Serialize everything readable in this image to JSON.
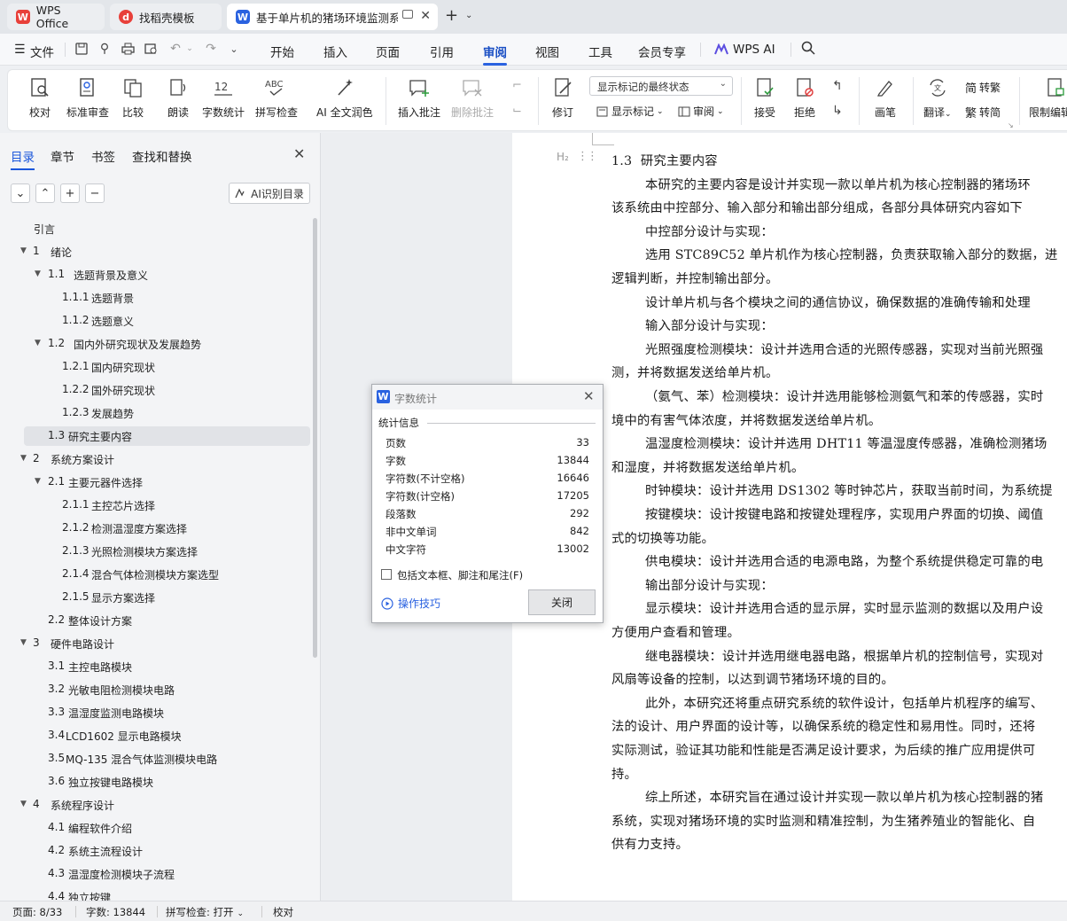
{
  "tabs": {
    "wps_office": "WPS Office",
    "template": "找稻壳模板",
    "document": "基于单片机的猪场环境监测系"
  },
  "menu": {
    "file": "文件",
    "items": [
      "开始",
      "插入",
      "页面",
      "引用",
      "审阅",
      "视图",
      "工具",
      "会员专享"
    ],
    "active": "审阅",
    "wps_ai": "WPS AI"
  },
  "ribbon": {
    "proofread": "校对",
    "standard_review": "标准审查",
    "compare": "比较",
    "read_aloud": "朗读",
    "word_count": "字数统计",
    "spell_check": "拼写检查",
    "ai_polish": "AI 全文润色",
    "insert_comment": "插入批注",
    "delete_comment": "删除批注",
    "track_changes": "修订",
    "markup_select": "显示标记的最终状态",
    "show_markup": "显示标记",
    "review": "审阅",
    "accept": "接受",
    "reject": "拒绝",
    "pen": "画笔",
    "translate": "翻译",
    "to_traditional": "转繁",
    "to_simplified": "转简",
    "restrict_edit": "限制编辑"
  },
  "nav": {
    "tabs": [
      "目录",
      "章节",
      "书签",
      "查找和替换"
    ],
    "active_tab": "目录",
    "ai_toc": "AI识别目录",
    "toc": [
      {
        "num": "",
        "label": "引言",
        "level": 0,
        "toggle": ""
      },
      {
        "num": "1",
        "label": "绪论",
        "level": 0,
        "toggle": "▼"
      },
      {
        "num": "1.1",
        "label": "选题背景及意义",
        "level": 1,
        "toggle": "▼"
      },
      {
        "num": "1.1.1",
        "label": "选题背景",
        "level": 2,
        "toggle": ""
      },
      {
        "num": "1.1.2",
        "label": "选题意义",
        "level": 2,
        "toggle": ""
      },
      {
        "num": "1.2",
        "label": "国内外研究现状及发展趋势",
        "level": 1,
        "toggle": "▼"
      },
      {
        "num": "1.2.1",
        "label": "国内研究现状",
        "level": 2,
        "toggle": ""
      },
      {
        "num": "1.2.2",
        "label": "国外研究现状",
        "level": 2,
        "toggle": ""
      },
      {
        "num": "1.2.3",
        "label": "发展趋势",
        "level": 2,
        "toggle": ""
      },
      {
        "num": "1.3",
        "label": "研究主要内容",
        "level": 1,
        "toggle": "",
        "selected": true
      },
      {
        "num": "2",
        "label": "系统方案设计",
        "level": 0,
        "toggle": "▼"
      },
      {
        "num": "2.1",
        "label": "主要元器件选择",
        "level": 1,
        "toggle": "▼"
      },
      {
        "num": "2.1.1",
        "label": "主控芯片选择",
        "level": 2,
        "toggle": ""
      },
      {
        "num": "2.1.2",
        "label": "检测温湿度方案选择",
        "level": 2,
        "toggle": ""
      },
      {
        "num": "2.1.3",
        "label": "光照检测模块方案选择",
        "level": 2,
        "toggle": ""
      },
      {
        "num": "2.1.4",
        "label": "混合气体检测模块方案选型",
        "level": 2,
        "toggle": ""
      },
      {
        "num": "2.1.5",
        "label": "显示方案选择",
        "level": 2,
        "toggle": ""
      },
      {
        "num": "2.2",
        "label": "整体设计方案",
        "level": 1,
        "toggle": ""
      },
      {
        "num": "3",
        "label": "硬件电路设计",
        "level": 0,
        "toggle": "▼"
      },
      {
        "num": "3.1",
        "label": "主控电路模块",
        "level": 1,
        "toggle": ""
      },
      {
        "num": "3.2",
        "label": "光敏电阻检测模块电路",
        "level": 1,
        "toggle": ""
      },
      {
        "num": "3.3",
        "label": "温湿度监测电路模块",
        "level": 1,
        "toggle": ""
      },
      {
        "num": "3.4",
        "label": "LCD1602 显示电路模块",
        "level": 1,
        "toggle": ""
      },
      {
        "num": "3.5",
        "label": "MQ-135 混合气体监测模块电路",
        "level": 1,
        "toggle": ""
      },
      {
        "num": "3.6",
        "label": "独立按键电路模块",
        "level": 1,
        "toggle": ""
      },
      {
        "num": "4",
        "label": "系统程序设计",
        "level": 0,
        "toggle": "▼"
      },
      {
        "num": "4.1",
        "label": "编程软件介绍",
        "level": 1,
        "toggle": ""
      },
      {
        "num": "4.2",
        "label": "系统主流程设计",
        "level": 1,
        "toggle": ""
      },
      {
        "num": "4.3",
        "label": "温湿度检测模块子流程",
        "level": 1,
        "toggle": ""
      },
      {
        "num": "4.4",
        "label": "独立按键",
        "level": 1,
        "toggle": ""
      }
    ]
  },
  "document": {
    "heading_marker": "H₂",
    "lines": [
      "1.3  研究主要内容",
      "        本研究的主要内容是设计并实现一款以单片机为核心控制器的猪场环",
      "该系统由中控部分、输入部分和输出部分组成，各部分具体研究内容如下",
      "        中控部分设计与实现：",
      "        选用 STC89C52 单片机作为核心控制器，负责获取输入部分的数据，进",
      "逻辑判断，并控制输出部分。",
      "        设计单片机与各个模块之间的通信协议，确保数据的准确传输和处理",
      "        输入部分设计与实现：",
      "        光照强度检测模块：设计并选用合适的光照传感器，实现对当前光照强",
      "测，并将数据发送给单片机。",
      "        （氨气、苯）检测模块：设计并选用能够检测氨气和苯的传感器，实时",
      "境中的有害气体浓度，并将数据发送给单片机。",
      "        温湿度检测模块：设计并选用 DHT11 等温湿度传感器，准确检测猪场",
      "和湿度，并将数据发送给单片机。",
      "        时钟模块：设计并选用 DS1302 等时钟芯片，获取当前时间，为系统提",
      "        按键模块：设计按键电路和按键处理程序，实现用户界面的切换、阈值",
      "式的切换等功能。",
      "        供电模块：设计并选用合适的电源电路，为整个系统提供稳定可靠的电",
      "        输出部分设计与实现：",
      "        显示模块：设计并选用合适的显示屏，实时显示监测的数据以及用户设",
      "方便用户查看和管理。",
      "        继电器模块：设计并选用继电器电路，根据单片机的控制信号，实现对",
      "风扇等设备的控制，以达到调节猪场环境的目的。",
      "        此外，本研究还将重点研究系统的软件设计，包括单片机程序的编写、",
      "法的设计、用户界面的设计等，以确保系统的稳定性和易用性。同时，还将",
      "实际测试，验证其功能和性能是否满足设计要求，为后续的推广应用提供可",
      "持。",
      "        综上所述，本研究旨在通过设计并实现一款以单片机为核心控制器的猪",
      "系统，实现对猪场环境的实时监测和精准控制，为生猪养殖业的智能化、自",
      "供有力支持。"
    ]
  },
  "dialog": {
    "title": "字数统计",
    "section": "统计信息",
    "stats": [
      {
        "label": "页数",
        "value": "33"
      },
      {
        "label": "字数",
        "value": "13844"
      },
      {
        "label": "字符数(不计空格)",
        "value": "16646"
      },
      {
        "label": "字符数(计空格)",
        "value": "17205"
      },
      {
        "label": "段落数",
        "value": "292"
      },
      {
        "label": "非中文单词",
        "value": "842"
      },
      {
        "label": "中文字符",
        "value": "13002"
      }
    ],
    "checkbox_label": "包括文本框、脚注和尾注(F)",
    "checkbox_checked": false,
    "tips_link": "操作技巧",
    "close_button": "关闭"
  },
  "status": {
    "page": "页面: 8/33",
    "words": "字数: 13844",
    "spell": "拼写检查: 打开",
    "proof": "校对"
  },
  "colors": {
    "accent": "#1a56db",
    "wps_red": "#e8403a",
    "wps_blue": "#2a62e0"
  }
}
